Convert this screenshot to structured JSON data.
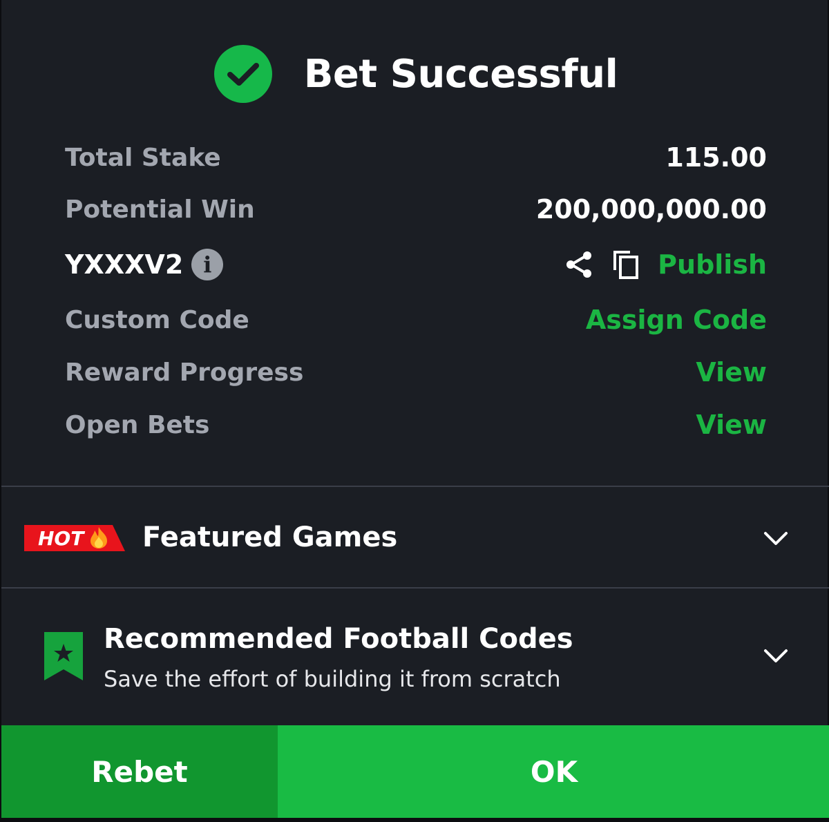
{
  "header": {
    "title": "Bet Successful",
    "icon": "check-circle-icon"
  },
  "summary": {
    "total_stake_label": "Total Stake",
    "total_stake_value": "115.00",
    "potential_win_label": "Potential Win",
    "potential_win_value": "200,000,000.00",
    "booking_code": "YXXXV2",
    "publish_label": "Publish",
    "custom_code_label": "Custom Code",
    "assign_code_label": "Assign Code",
    "reward_progress_label": "Reward Progress",
    "reward_progress_link": "View",
    "open_bets_label": "Open Bets",
    "open_bets_link": "View"
  },
  "featured": {
    "badge": "HOT",
    "title": "Featured Games"
  },
  "recommended": {
    "title": "Recommended Football Codes",
    "subtitle": "Save the effort of building it from scratch"
  },
  "buttons": {
    "rebet": "Rebet",
    "ok": "OK"
  },
  "colors": {
    "background": "#1b1e24",
    "accent_green": "#1bb543",
    "button_rebet": "#11962f",
    "button_ok": "#19bb44",
    "hot_red": "#e8141c"
  }
}
